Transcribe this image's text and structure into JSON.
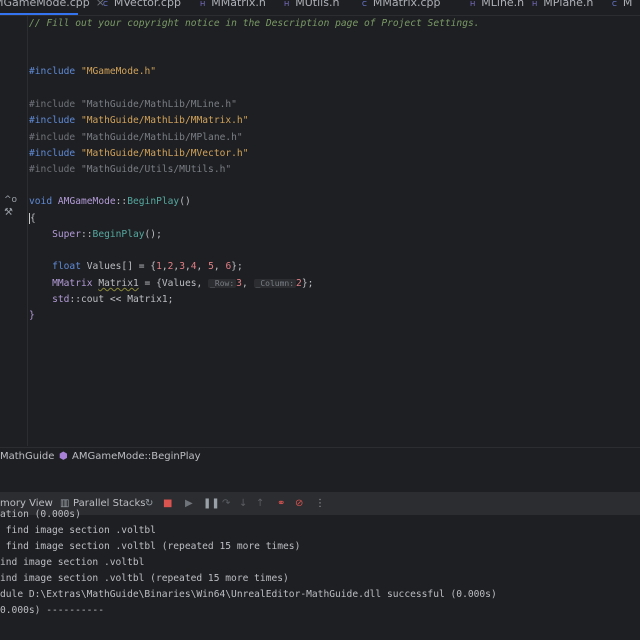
{
  "tabs": [
    {
      "label": "MGameMode.cpp",
      "icon": "cpp-file-icon",
      "active": true,
      "close": "×"
    },
    {
      "label": "MVector.cpp",
      "icon": "cpp-file-icon"
    },
    {
      "label": "MMatrix.h",
      "icon": "header-file-icon"
    },
    {
      "label": "MUtils.h",
      "icon": "header-file-icon"
    },
    {
      "label": "MMatrix.cpp",
      "icon": "cpp-file-icon"
    },
    {
      "label": "MLine.h",
      "icon": "header-file-icon"
    },
    {
      "label": "MPlane.h",
      "icon": "header-file-icon"
    },
    {
      "label": "M",
      "icon": "cpp-file-icon"
    }
  ],
  "code": [
    [
      [
        "// Fill out your copyright notice in the Description page of Project Settings.",
        "cm"
      ]
    ],
    [],
    [],
    [
      [
        "#include ",
        "k"
      ],
      [
        "\"MGameMode.h\"",
        "s"
      ]
    ],
    [],
    [
      [
        "#include ",
        "dim"
      ],
      [
        "\"MathGuide/MathLib/MLine.h\"",
        "dims"
      ]
    ],
    [
      [
        "#include ",
        "k"
      ],
      [
        "\"MathGuide/MathLib/MMatrix.h\"",
        "s"
      ]
    ],
    [
      [
        "#include ",
        "dim"
      ],
      [
        "\"MathGuide/MathLib/MPlane.h\"",
        "dims"
      ]
    ],
    [
      [
        "#include ",
        "k"
      ],
      [
        "\"MathGuide/MathLib/MVector.h\"",
        "s"
      ]
    ],
    [
      [
        "#include ",
        "dim"
      ],
      [
        "\"MathGuide/Utils/MUtils.h\"",
        "dims"
      ]
    ],
    [],
    [
      [
        "void ",
        "k"
      ],
      [
        "AMGameMode",
        "ty"
      ],
      [
        "::",
        "pl"
      ],
      [
        "BeginPlay",
        "fn"
      ],
      [
        "()",
        "pl"
      ]
    ],
    [
      [
        "{",
        "caret pl"
      ]
    ],
    [
      [
        "    Super",
        "ty"
      ],
      [
        "::",
        "pl"
      ],
      [
        "BeginPlay",
        "fn"
      ],
      [
        "();",
        "pl"
      ]
    ],
    [],
    [
      [
        "    float ",
        "k"
      ],
      [
        "Values[] = {",
        "pl"
      ],
      [
        "1",
        "num"
      ],
      [
        ",",
        "pl"
      ],
      [
        "2",
        "num"
      ],
      [
        ",",
        "pl"
      ],
      [
        "3",
        "num"
      ],
      [
        ",",
        "pl"
      ],
      [
        "4",
        "num"
      ],
      [
        ", ",
        "pl"
      ],
      [
        "5",
        "num"
      ],
      [
        ", ",
        "pl"
      ],
      [
        "6",
        "num"
      ],
      [
        "};",
        "pl"
      ]
    ],
    [
      [
        "    MMatrix ",
        "ty"
      ],
      [
        "Matrix1",
        "wv pl"
      ],
      [
        " = {Values, ",
        "pl"
      ],
      [
        "_Row:",
        "hint"
      ],
      [
        "3",
        "num"
      ],
      [
        ", ",
        "pl"
      ],
      [
        "_Column:",
        "hint"
      ],
      [
        "2",
        "num"
      ],
      [
        "};",
        "pl"
      ]
    ],
    [
      [
        "    std",
        "ty"
      ],
      [
        "::cout << Matrix1;",
        "pl"
      ]
    ],
    [
      [
        "}",
        "ty"
      ]
    ]
  ],
  "gutter": {
    "implements_icon": "^o",
    "build_icon": "hammer-icon"
  },
  "breadcrumb": {
    "items": [
      "MathGuide",
      "AMGameMode::BeginPlay"
    ],
    "icon": "method-icon"
  },
  "debug_toolbar": {
    "tabs": [
      "mory View",
      "Parallel Stacks"
    ],
    "icons": [
      "rerun-icon",
      "stop-icon",
      "resume-icon",
      "pause-icon",
      "step-over-icon",
      "step-into-icon",
      "step-out-icon",
      "breakpoints-icon",
      "mute-breakpoints-icon",
      "more-icon"
    ]
  },
  "console": [
    "ation (0.000s)",
    " find image section .voltbl",
    " find image section .voltbl (repeated 15 more times)",
    "ind image section .voltbl",
    "ind image section .voltbl (repeated 15 more times)",
    "dule D:\\Extras\\MathGuide\\Binaries\\Win64\\UnrealEditor-MathGuide.dll successful (0.000s)",
    "0.000s) ----------"
  ]
}
